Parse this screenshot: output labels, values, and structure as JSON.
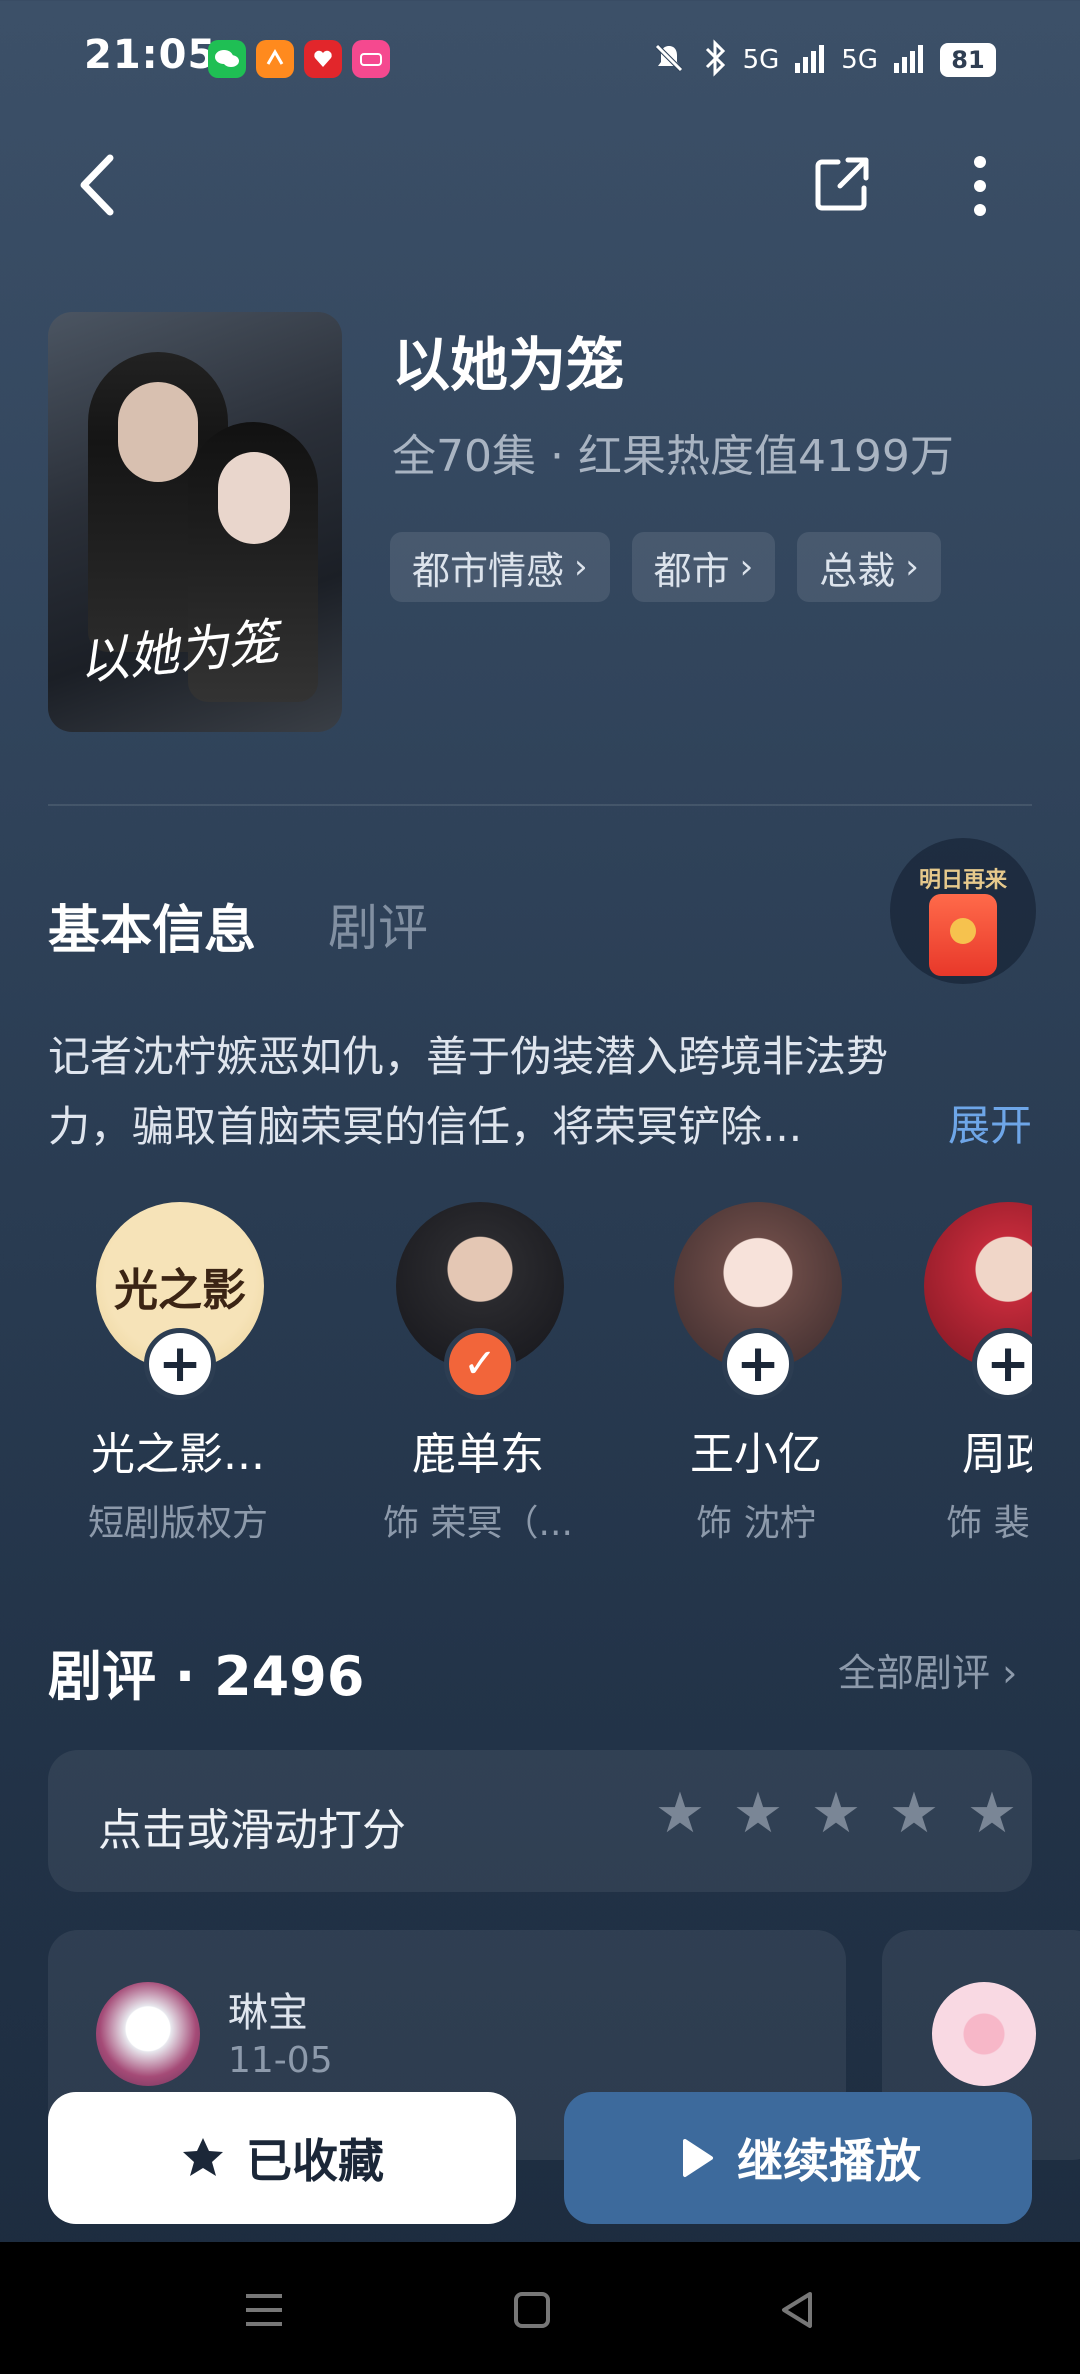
{
  "status_bar": {
    "time": "21:05",
    "app_icons": [
      "wechat-icon",
      "app-orange-icon",
      "app-red-icon",
      "app-pink-icon"
    ],
    "signal_1": "5G",
    "signal_2": "5G",
    "battery": "81"
  },
  "header": {
    "title": "以她为笼",
    "meta": "全70集 · 红果热度值4199万",
    "poster_title": "以她为笼",
    "tags": [
      "都市情感",
      "都市",
      "总裁"
    ]
  },
  "tabs": {
    "basic": "基本信息",
    "review": "剧评",
    "redpacket_label": "明日再来"
  },
  "synopsis": {
    "text": "记者沈柠嫉恶如仇，善于伪装潜入跨境非法势力，骗取首脑荣冥的信任，将荣冥铲除...",
    "expand": "展开"
  },
  "cast": [
    {
      "name": "光之影...",
      "role": "短剧版权方",
      "followed": false
    },
    {
      "name": "鹿单东",
      "role": "饰 荣冥（...",
      "followed": true
    },
    {
      "name": "王小亿",
      "role": "饰 沈柠",
      "followed": false
    },
    {
      "name": "周政",
      "role": "饰 裴明",
      "followed": false
    }
  ],
  "reviews": {
    "title": "剧评 · 2496",
    "all_label": "全部剧评",
    "rating_prompt": "点击或滑动打分",
    "star_count": 5,
    "items": [
      {
        "user": "琳宝",
        "date": "11-05"
      }
    ]
  },
  "actions": {
    "favorite": "已收藏",
    "play": "继续播放"
  },
  "colors": {
    "accent_blue": "#3d6a9c",
    "followed_orange": "#f2653a",
    "link_blue": "#6ea6e8"
  }
}
